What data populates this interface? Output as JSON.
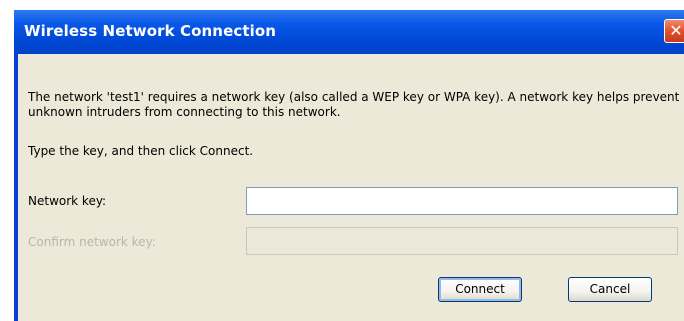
{
  "window": {
    "title": "Wireless Network Connection",
    "close_glyph": "✕"
  },
  "dialog": {
    "message": "The network 'test1' requires a network key (also called a WEP key or WPA key). A network key helps prevent unknown intruders from connecting to this network.",
    "instruction": "Type the key, and then click Connect.",
    "network_key_label": "Network key:",
    "network_key_value": "",
    "confirm_key_label": "Confirm network key:",
    "confirm_key_value": "",
    "connect_label": "Connect",
    "cancel_label": "Cancel"
  },
  "colors": {
    "titlebar": "#0048d6",
    "client": "#ece9d8",
    "close": "#e0512e",
    "disabled_text": "#b8b6a9"
  }
}
